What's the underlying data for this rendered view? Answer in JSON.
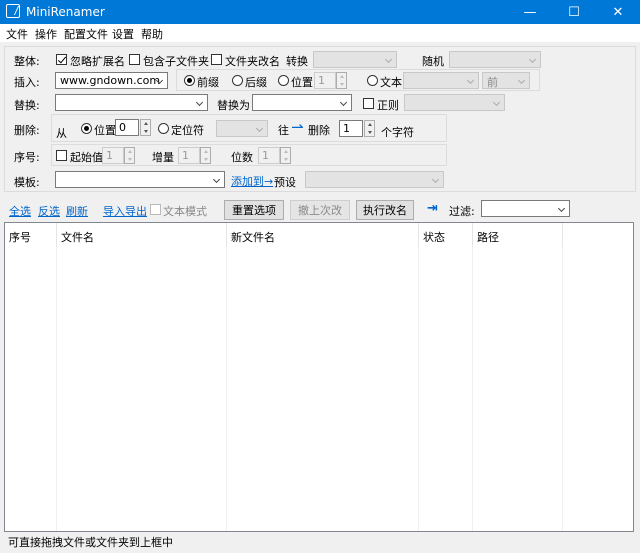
{
  "window": {
    "title": "MiniRenamer",
    "minimize": "—",
    "maximize": "☐",
    "close": "✕"
  },
  "menu": [
    "文件",
    "操作",
    "配置文件",
    "设置",
    "帮助"
  ],
  "whole": {
    "label": "整体:",
    "ignore_ext": "忽略扩展名",
    "include_sub": "包含子文件夹",
    "folder_rename": "文件夹改名",
    "convert_label": "转换",
    "random_label": "随机"
  },
  "insert": {
    "label": "插入:",
    "value": "www.gndown.com",
    "prefix": "前缀",
    "suffix": "后缀",
    "position": "位置",
    "position_value": "1",
    "text": "文本",
    "text_select": "前"
  },
  "replace": {
    "label": "替换:",
    "value": "",
    "to_label": "替换为",
    "to_value": "",
    "regex": "正则"
  },
  "delete": {
    "label": "删除:",
    "from": "从",
    "position": "位置",
    "position_value": "0",
    "locator": "定位符",
    "to": "往",
    "arrow": "⇀",
    "delete_word": "删除",
    "count": "1",
    "unit": "个字符"
  },
  "seq": {
    "label": "序号:",
    "start": "起始值",
    "start_value": "1",
    "step": "增量",
    "step_value": "1",
    "digits": "位数",
    "digits_value": "1"
  },
  "template": {
    "label": "模板:",
    "value": "",
    "add_link": "添加到→",
    "preset": "预设"
  },
  "toolbar": {
    "select_all": "全选",
    "invert": "反选",
    "refresh": "刷新",
    "import_export": "导入导出",
    "text_mode": "文本模式",
    "reset": "重置选项",
    "undo": "撤上次改",
    "execute": "执行改名",
    "filter": "过滤:"
  },
  "table": {
    "headers": [
      "序号",
      "文件名",
      "新文件名",
      "状态",
      "路径"
    ]
  },
  "status": "可直接拖拽文件或文件夹到上框中",
  "colors": {
    "titlebar": "#0078d7",
    "link": "#0066cc"
  }
}
